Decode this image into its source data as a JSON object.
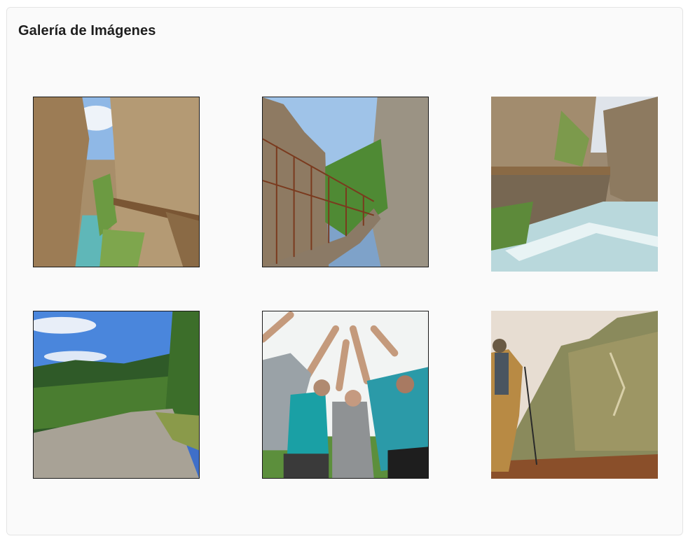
{
  "gallery": {
    "title": "Galería de Imágenes",
    "images": [
      {
        "subject": "gorge-boardwalk-river"
      },
      {
        "subject": "suspension-bridge-canyon"
      },
      {
        "subject": "canyon-walkway-rapids"
      },
      {
        "subject": "gravel-mountain-trail"
      },
      {
        "subject": "group-high-five"
      },
      {
        "subject": "hiker-mountain-view"
      }
    ]
  }
}
